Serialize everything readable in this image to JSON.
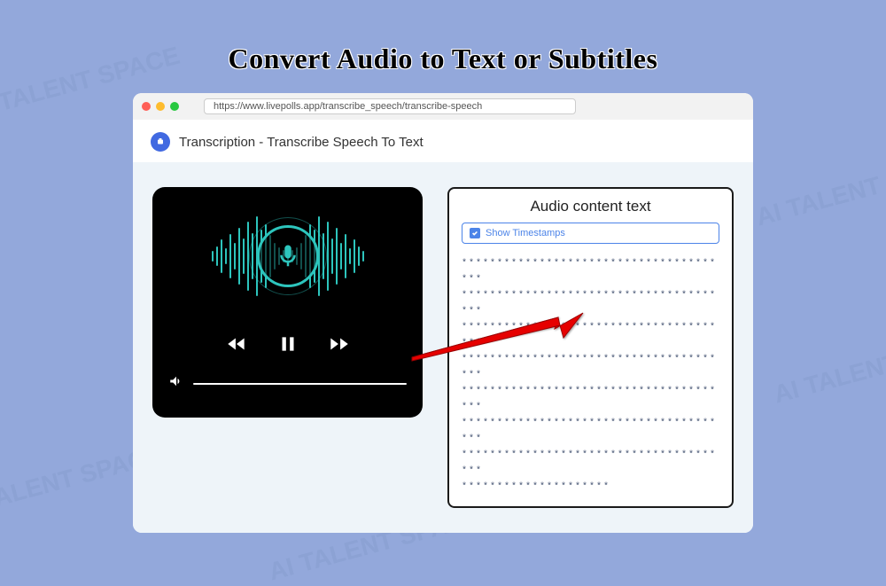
{
  "page": {
    "title": "Convert Audio to Text or Subtitles",
    "watermark": "AI TALENT SPACE"
  },
  "browser": {
    "url": "https://www.livepolls.app/transcribe_speech/transcribe-speech"
  },
  "app": {
    "title": "Transcription - Transcribe Speech To Text"
  },
  "transcript": {
    "title": "Audio content text",
    "toggle_label": "Show Timestamps",
    "body": "***************************************\n***************************************\n***************************************\n***************************************\n***************************************\n***************************************\n***************************************\n*********************"
  }
}
